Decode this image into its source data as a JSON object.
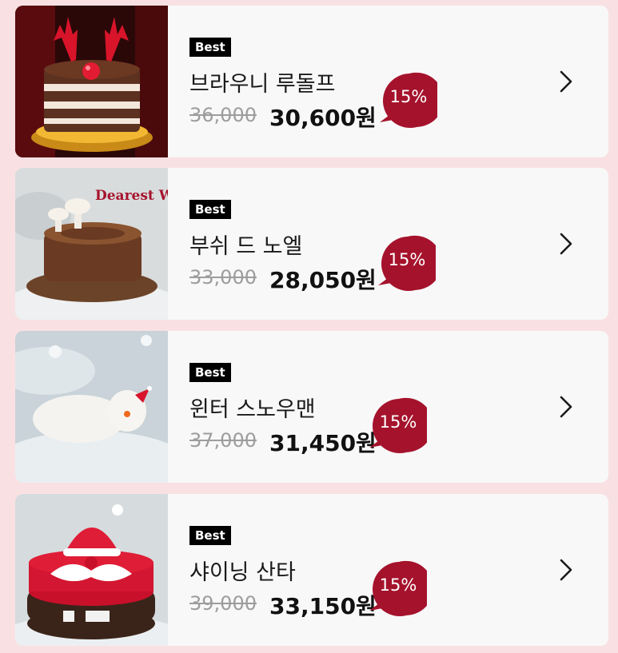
{
  "products": [
    {
      "badge": "Best",
      "name": "브라우니 루돌프",
      "original_price": "36,000",
      "sale_price": "30,600원",
      "discount": "15%",
      "image": "reindeer-brownie-cake-image"
    },
    {
      "badge": "Best",
      "name": "부쉬 드 노엘",
      "original_price": "33,000",
      "sale_price": "28,050원",
      "discount": "15%",
      "image": "log-cake-image",
      "image_caption": "Dearest Winter"
    },
    {
      "badge": "Best",
      "name": "윈터 스노우맨",
      "original_price": "37,000",
      "sale_price": "31,450원",
      "discount": "15%",
      "image": "snowman-cake-image"
    },
    {
      "badge": "Best",
      "name": "샤이닝 산타",
      "original_price": "39,000",
      "sale_price": "33,150원",
      "discount": "15%",
      "image": "santa-cake-image"
    }
  ],
  "colors": {
    "page_background": "#f9e1e3",
    "card_background": "#f8f8f8",
    "discount_bubble": "#a5122c",
    "badge_background": "#000000"
  }
}
